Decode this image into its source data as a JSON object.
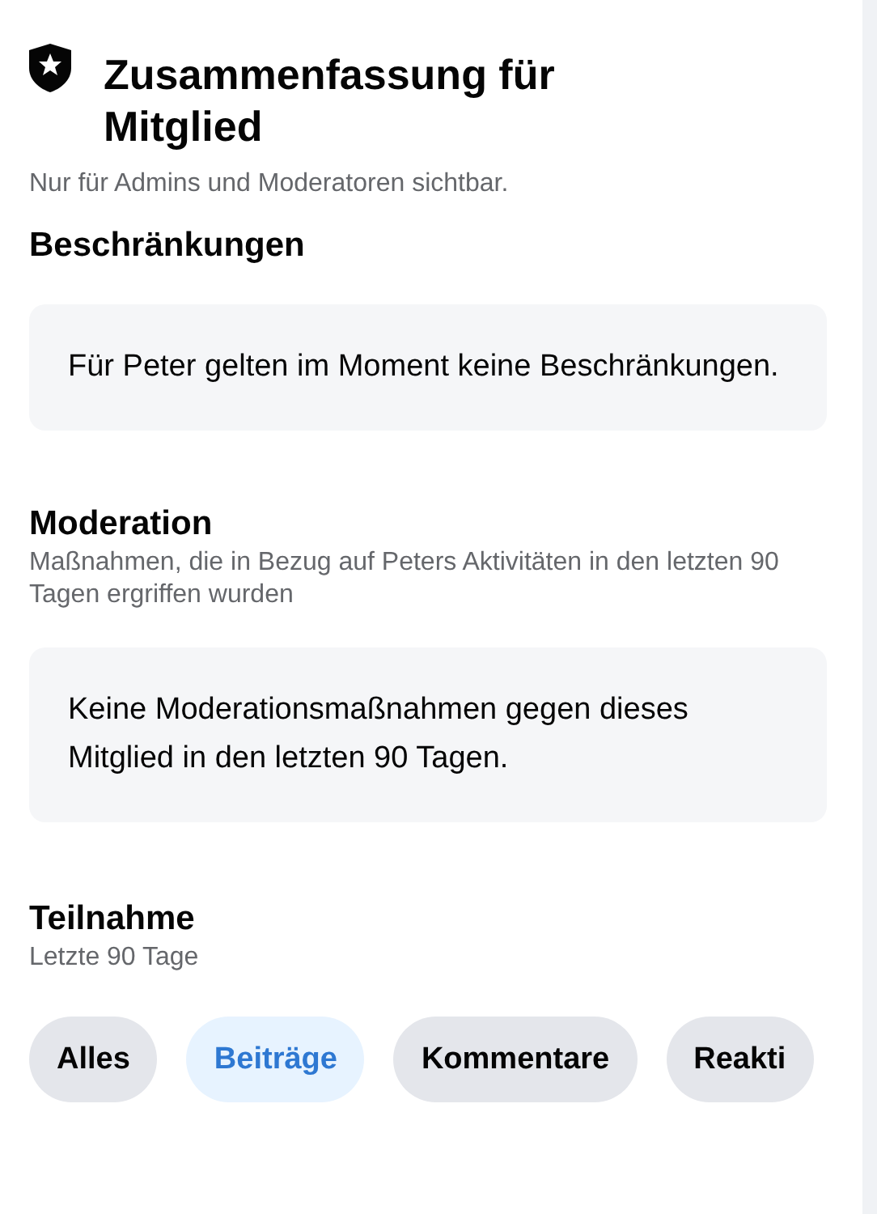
{
  "header": {
    "title": "Zusammenfassung für Mitglied",
    "subtitle": "Nur für Admins und Moderatoren sichtbar."
  },
  "sections": [
    {
      "title": "Beschränkungen",
      "card_text": "Für Peter gelten im Moment keine Beschränkungen."
    },
    {
      "title": "Moderation",
      "subtitle": "Maßnahmen, die in Bezug auf Peters Aktivitäten in den letzten 90 Tagen ergriffen wurden",
      "card_text": "Keine Moderationsmaßnahmen gegen dieses Mitglied in den letzten 90 Tagen."
    }
  ],
  "participation": {
    "title": "Teilnahme",
    "subtitle": "Letzte 90 Tage",
    "filters": [
      {
        "label": "Alles",
        "selected": false
      },
      {
        "label": "Beiträge",
        "selected": true
      },
      {
        "label": "Kommentare",
        "selected": false
      },
      {
        "label": "Reakti",
        "selected": false
      }
    ]
  }
}
